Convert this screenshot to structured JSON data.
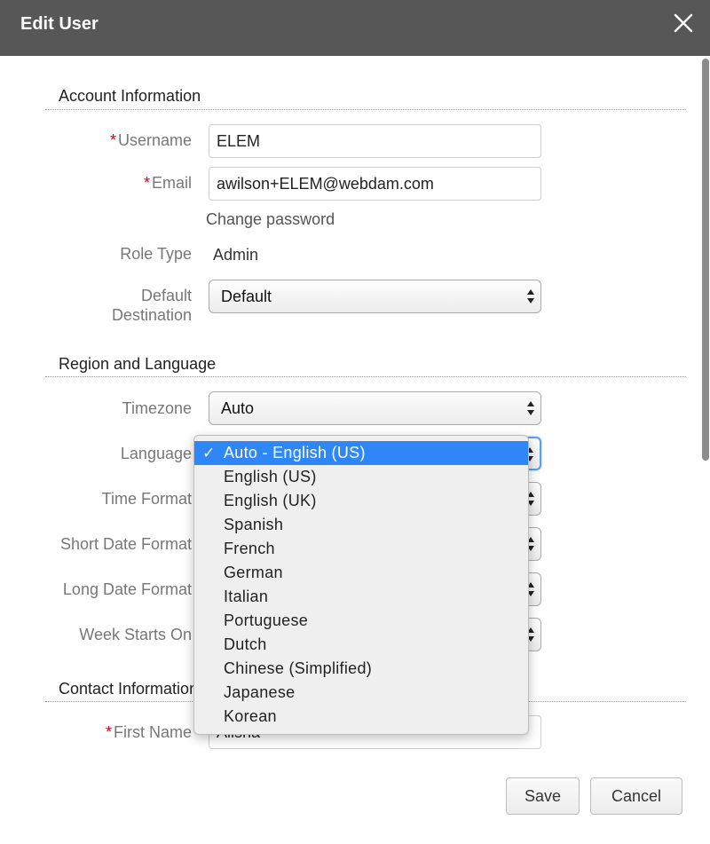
{
  "header": {
    "title": "Edit User"
  },
  "account": {
    "title": "Account Information",
    "username_label": "Username",
    "username_value": "ELEM",
    "email_label": "Email",
    "email_value": "awilson+ELEM@webdam.com",
    "change_password": "Change password",
    "role_type_label": "Role Type",
    "role_type_value": "Admin",
    "default_destination_label_1": "Default",
    "default_destination_label_2": "Destination",
    "default_destination_value": "Default"
  },
  "region": {
    "title": "Region and Language",
    "timezone_label": "Timezone",
    "timezone_value": "Auto",
    "language_label": "Language",
    "time_format_label": "Time Format",
    "short_date_label": "Short Date Format",
    "long_date_label": "Long Date Format",
    "week_starts_label": "Week Starts On"
  },
  "contact": {
    "title": "Contact Information",
    "first_name_label": "First Name",
    "first_name_value": "Alisha"
  },
  "language_dropdown": {
    "options": [
      "Auto - English (US)",
      "English (US)",
      "English (UK)",
      "Spanish",
      "French",
      "German",
      "Italian",
      "Portuguese",
      "Dutch",
      "Chinese (Simplified)",
      "Japanese",
      "Korean"
    ],
    "selected_index": 0,
    "check_mark": "✓"
  },
  "footer": {
    "save_label": "Save",
    "cancel_label": "Cancel"
  },
  "icons": {
    "close": "close-icon",
    "select_arrows": "up-down-arrows-icon"
  }
}
